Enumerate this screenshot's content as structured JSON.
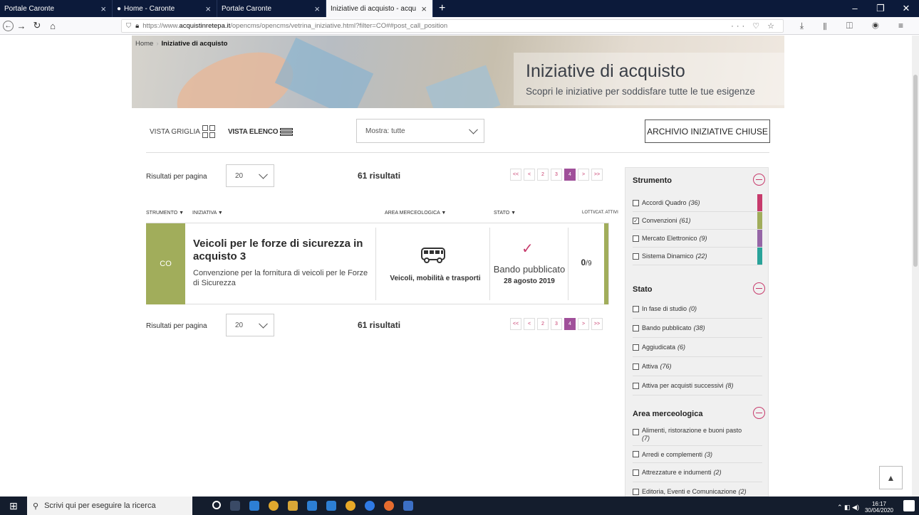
{
  "browser": {
    "tabs": [
      {
        "label": "Portale Caronte",
        "active": false
      },
      {
        "label": "Home - Caronte",
        "active": false
      },
      {
        "label": "Portale Caronte",
        "active": false
      },
      {
        "label": "Iniziative di acquisto - acquistinrete",
        "active": true
      }
    ],
    "url_prefix": "https://www.",
    "url_domain": "acquistinretepa.it",
    "url_path": "/opencms/opencms/vetrina_iniziative.html?filter=CO##post_call_position"
  },
  "breadcrumb": {
    "home": "Home",
    "current": "Iniziative di acquisto"
  },
  "hero": {
    "title": "Iniziative di acquisto",
    "subtitle": "Scopri le iniziative per soddisfare tutte le tue esigenze"
  },
  "views": {
    "grid_label": "VISTA GRIGLIA",
    "list_label": "VISTA ELENCO"
  },
  "filter": {
    "show_value": "Mostra: tutte"
  },
  "archive_button": "ARCHIVIO INIZIATIVE CHIUSE",
  "pagination": {
    "per_page_label": "Risultati per pagina",
    "per_page_value": "20",
    "results": "61 risultati",
    "pages": [
      "<<",
      "<",
      "2",
      "3",
      "4",
      ">",
      ">>"
    ],
    "current": "4"
  },
  "columns": {
    "strumento": "STRUMENTO ▼",
    "iniziativa": "INIZIATIVA ▼",
    "area": "AREA MERCEOLOGICA ▼",
    "stato": "STATO ▼",
    "lotti": "LOTTI/CAT. ATTIVI"
  },
  "initiative": {
    "badge": "CO",
    "title": "Veicoli per le forze di sicurezza in acquisto 3",
    "description": "Convenzione per la fornitura di veicoli per le Forze di Sicurezza",
    "area": "Veicoli, mobilità e trasporti",
    "status": "Bando pubblicato",
    "date": "28 agosto 2019",
    "lotti_active": "0",
    "lotti_total": "/9",
    "accent_color": "#a1ad5b"
  },
  "sidebar": {
    "strumento": {
      "title": "Strumento",
      "items": [
        {
          "label": "Accordi Quadro",
          "count": "(36)",
          "checked": false,
          "color": "#c73b6c"
        },
        {
          "label": "Convenzioni",
          "count": "(61)",
          "checked": true,
          "color": "#a1ad5b"
        },
        {
          "label": "Mercato Elettronico",
          "count": "(9)",
          "checked": false,
          "color": "#9566a6"
        },
        {
          "label": "Sistema Dinamico",
          "count": "(22)",
          "checked": false,
          "color": "#2aa39a"
        }
      ]
    },
    "stato": {
      "title": "Stato",
      "items": [
        {
          "label": "In fase di studio",
          "count": "(0)"
        },
        {
          "label": "Bando pubblicato",
          "count": "(38)"
        },
        {
          "label": "Aggiudicata",
          "count": "(6)"
        },
        {
          "label": "Attiva",
          "count": "(76)"
        },
        {
          "label": "Attiva per acquisti successivi",
          "count": "(8)"
        }
      ]
    },
    "area": {
      "title": "Area merceologica",
      "items": [
        {
          "label": "Alimenti, ristorazione e buoni pasto",
          "count": "(7)"
        },
        {
          "label": "Arredi e complementi",
          "count": "(3)"
        },
        {
          "label": "Attrezzature e indumenti",
          "count": "(2)"
        },
        {
          "label": "Editoria, Eventi e Comunicazione",
          "count": "(2)"
        }
      ]
    }
  },
  "taskbar": {
    "search_placeholder": "Scrivi qui per eseguire la ricerca",
    "time": "16:17",
    "date": "30/04/2020"
  }
}
